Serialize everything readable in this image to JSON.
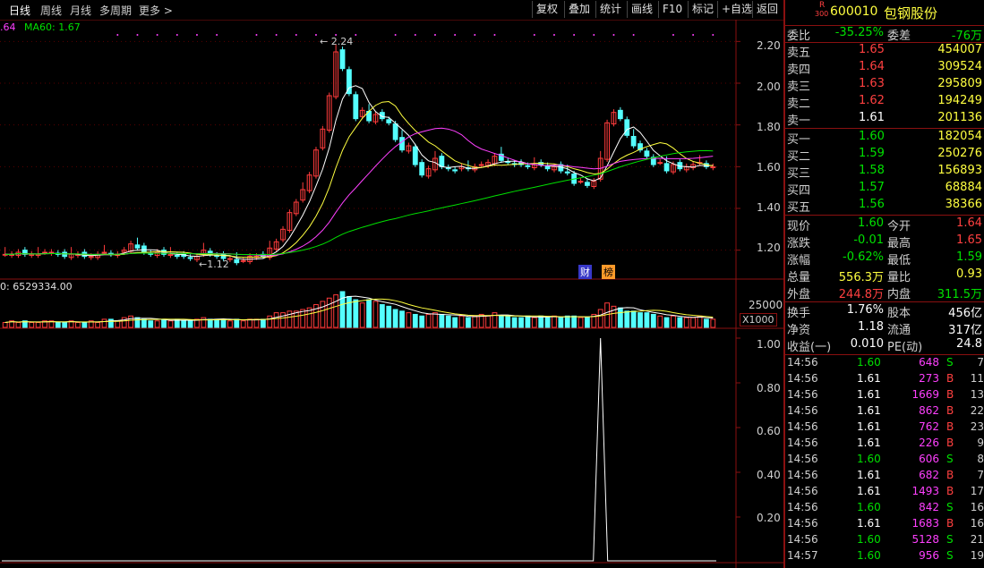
{
  "toolbar": {
    "tabs": [
      "日线",
      "周线",
      "月线",
      "多周期",
      "更多 >"
    ],
    "buttons": [
      "复权",
      "叠加",
      "统计",
      "画线",
      "F10",
      "标记",
      "+自选",
      "返回"
    ]
  },
  "ma_legend": {
    "left": ".64",
    "ma60": "MA60: 1.67"
  },
  "price_axis": [
    "2.20",
    "2.00",
    "1.80",
    "1.60",
    "1.40",
    "1.20"
  ],
  "annotations": {
    "high": "2.24",
    "low": "1.12",
    "badge_cai": "财",
    "badge_bang": "榜"
  },
  "volume": {
    "legend": "0: 6529334.00",
    "axis_value": "25000",
    "axis_unit": "X1000"
  },
  "indicator_axis": [
    "1.00",
    "0.80",
    "0.60",
    "0.40",
    "0.20"
  ],
  "quote": {
    "exchange_badge": "R",
    "exchange_sub": "300",
    "code": "600010",
    "name": "包钢股份",
    "weibi_label": "委比",
    "weibi": "-35.25%",
    "weicha_label": "委差",
    "weicha": "-76万",
    "asks": [
      {
        "label": "卖五",
        "price": "1.65",
        "vol": "454007"
      },
      {
        "label": "卖四",
        "price": "1.64",
        "vol": "309524"
      },
      {
        "label": "卖三",
        "price": "1.63",
        "vol": "295809"
      },
      {
        "label": "卖二",
        "price": "1.62",
        "vol": "194249"
      },
      {
        "label": "卖一",
        "price": "1.61",
        "vol": "201136"
      }
    ],
    "bids": [
      {
        "label": "买一",
        "price": "1.60",
        "vol": "182054"
      },
      {
        "label": "买二",
        "price": "1.59",
        "vol": "250276"
      },
      {
        "label": "买三",
        "price": "1.58",
        "vol": "156893"
      },
      {
        "label": "买四",
        "price": "1.57",
        "vol": "68884"
      },
      {
        "label": "买五",
        "price": "1.56",
        "vol": "38366"
      }
    ],
    "stats": [
      [
        {
          "l": "现价",
          "v": "1.60",
          "c": "grn"
        },
        {
          "l": "今开",
          "v": "1.64",
          "c": "red"
        }
      ],
      [
        {
          "l": "涨跌",
          "v": "-0.01",
          "c": "grn"
        },
        {
          "l": "最高",
          "v": "1.65",
          "c": "red"
        }
      ],
      [
        {
          "l": "涨幅",
          "v": "-0.62%",
          "c": "grn"
        },
        {
          "l": "最低",
          "v": "1.59",
          "c": "grn"
        }
      ],
      [
        {
          "l": "总量",
          "v": "556.3万",
          "c": "yel"
        },
        {
          "l": "量比",
          "v": "0.93",
          "c": "yel"
        }
      ],
      [
        {
          "l": "外盘",
          "v": "244.8万",
          "c": "red"
        },
        {
          "l": "内盘",
          "v": "311.5万",
          "c": "grn"
        }
      ]
    ],
    "stats2": [
      [
        {
          "l": "换手",
          "v": "1.76%"
        },
        {
          "l": "股本",
          "v": "456亿"
        }
      ],
      [
        {
          "l": "净资",
          "v": "1.18"
        },
        {
          "l": "流通",
          "v": "317亿"
        }
      ],
      [
        {
          "l": "收益(一)",
          "v": "0.010"
        },
        {
          "l": "PE(动)",
          "v": "24.8"
        }
      ]
    ],
    "ticks": [
      {
        "t": "14:56",
        "p": "1.60",
        "pc": "grn",
        "v": "648",
        "s": "S",
        "n": "7"
      },
      {
        "t": "14:56",
        "p": "1.61",
        "pc": "wht",
        "v": "273",
        "s": "B",
        "n": "11"
      },
      {
        "t": "14:56",
        "p": "1.61",
        "pc": "wht",
        "v": "1669",
        "s": "B",
        "n": "13"
      },
      {
        "t": "14:56",
        "p": "1.61",
        "pc": "wht",
        "v": "862",
        "s": "B",
        "n": "22"
      },
      {
        "t": "14:56",
        "p": "1.61",
        "pc": "wht",
        "v": "762",
        "s": "B",
        "n": "23"
      },
      {
        "t": "14:56",
        "p": "1.61",
        "pc": "wht",
        "v": "226",
        "s": "B",
        "n": "9"
      },
      {
        "t": "14:56",
        "p": "1.60",
        "pc": "grn",
        "v": "606",
        "s": "S",
        "n": "8"
      },
      {
        "t": "14:56",
        "p": "1.61",
        "pc": "wht",
        "v": "682",
        "s": "B",
        "n": "7"
      },
      {
        "t": "14:56",
        "p": "1.61",
        "pc": "wht",
        "v": "1493",
        "s": "B",
        "n": "17"
      },
      {
        "t": "14:56",
        "p": "1.60",
        "pc": "grn",
        "v": "842",
        "s": "S",
        "n": "16"
      },
      {
        "t": "14:56",
        "p": "1.61",
        "pc": "wht",
        "v": "1683",
        "s": "B",
        "n": "16"
      },
      {
        "t": "14:56",
        "p": "1.60",
        "pc": "grn",
        "v": "5128",
        "s": "S",
        "n": "21"
      },
      {
        "t": "14:57",
        "p": "1.60",
        "pc": "grn",
        "v": "956",
        "s": "S",
        "n": "19"
      }
    ]
  },
  "chart_data": {
    "type": "candlestick",
    "y_range": [
      1.07,
      2.27
    ],
    "price_ticks": [
      2.2,
      2.0,
      1.8,
      1.6,
      1.4,
      1.2
    ],
    "colors": {
      "up": "#ff3c3c",
      "down": "#54ffff",
      "ma5": "#ffffff",
      "ma10": "#ffff40",
      "ma20": "#ff40ff",
      "ma60": "#00e000"
    },
    "close": [
      1.18,
      1.18,
      1.19,
      1.18,
      1.18,
      1.18,
      1.19,
      1.19,
      1.18,
      1.17,
      1.18,
      1.18,
      1.17,
      1.17,
      1.18,
      1.19,
      1.18,
      1.18,
      1.2,
      1.23,
      1.21,
      1.19,
      1.18,
      1.19,
      1.18,
      1.18,
      1.17,
      1.17,
      1.16,
      1.17,
      1.2,
      1.18,
      1.17,
      1.16,
      1.16,
      1.14,
      1.15,
      1.17,
      1.17,
      1.17,
      1.21,
      1.24,
      1.3,
      1.38,
      1.43,
      1.49,
      1.56,
      1.68,
      1.78,
      1.94,
      2.15,
      2.07,
      1.95,
      1.83,
      1.87,
      1.82,
      1.85,
      1.83,
      1.81,
      1.73,
      1.68,
      1.7,
      1.61,
      1.56,
      1.59,
      1.64,
      1.6,
      1.59,
      1.58,
      1.6,
      1.59,
      1.6,
      1.61,
      1.62,
      1.65,
      1.63,
      1.62,
      1.61,
      1.61,
      1.6,
      1.61,
      1.61,
      1.59,
      1.6,
      1.58,
      1.57,
      1.52,
      1.53,
      1.51,
      1.53,
      1.64,
      1.81,
      1.86,
      1.83,
      1.75,
      1.7,
      1.68,
      1.65,
      1.61,
      1.62,
      1.58,
      1.61,
      1.59,
      1.6,
      1.61,
      1.62,
      1.6,
      1.6
    ],
    "volume": [
      3,
      4,
      3,
      4,
      3,
      3,
      4,
      4,
      3,
      3,
      4,
      3,
      3,
      4,
      3,
      5,
      5,
      4,
      6,
      7,
      6,
      5,
      4,
      4,
      5,
      4,
      5,
      4,
      4,
      5,
      6,
      5,
      5,
      5,
      4,
      5,
      4,
      5,
      5,
      5,
      7,
      9,
      9,
      10,
      10,
      11,
      12,
      14,
      16,
      18,
      20,
      22,
      19,
      17,
      15,
      17,
      16,
      14,
      13,
      11,
      10,
      9,
      8,
      7,
      8,
      9,
      8,
      7,
      6,
      7,
      6,
      7,
      8,
      7,
      9,
      7,
      7,
      6,
      6,
      7,
      6,
      7,
      6,
      7,
      6,
      7,
      7,
      6,
      6,
      8,
      11,
      15,
      13,
      12,
      10,
      10,
      9,
      9,
      8,
      7,
      6,
      7,
      6,
      6,
      6,
      7,
      5,
      5
    ],
    "volume_axis": 25000,
    "indicator": {
      "spike_index": 90,
      "spike_value": 1.0
    }
  }
}
